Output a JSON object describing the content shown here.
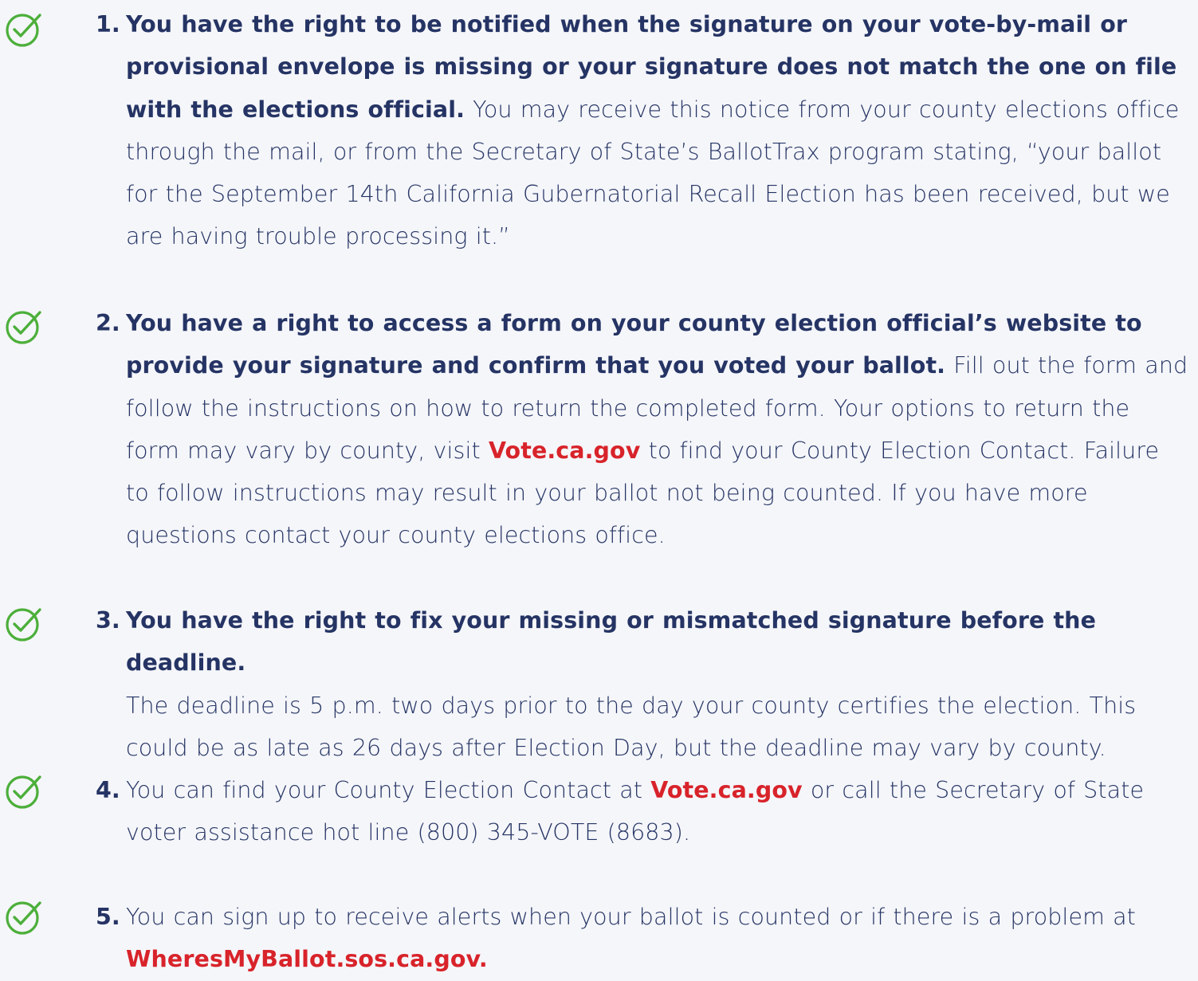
{
  "colors": {
    "background": "#f5f6fa",
    "text": "#253464",
    "link": "#d8232a",
    "check": "#4caf3a"
  },
  "items": [
    {
      "icon": "check-circle-icon",
      "number": "1.",
      "lead": "You have the right to be notified when the signature on your vote-by-mail or provisional envelope is missing or your signature does not match the one on file with the elections official.",
      "body": " You may receive this notice from your county elections office through the mail, or from the Secretary of State’s BallotTrax program stating, “your ballot for the September 14th California Gubernatorial Recall Election has been received, but we are having trouble processing it.”"
    },
    {
      "icon": "check-circle-icon",
      "number": "2.",
      "lead": "You have a right to access a form on your county election official’s website to provide your signature and confirm that you voted your ballot.",
      "body_before_link": " Fill out the form and follow the instructions on how to return the completed form. Your options to return the form may vary by county, visit ",
      "link": "Vote.ca.gov",
      "body_after_link": " to find your County Election Contact. Failure to follow instructions may result in your ballot not being counted. If you have more questions contact your county elections office."
    },
    {
      "icon": "check-circle-icon",
      "number": "3.",
      "lead": "You have the right to fix your missing or mismatched signature before the deadline.",
      "body": "The deadline is 5 p.m. two days prior to the day your county certifies the election. This could be as late as 26 days after Election Day, but the deadline may vary by county."
    },
    {
      "icon": "check-circle-icon",
      "number": "4.",
      "body_before_link": "You can find your County Election Contact at ",
      "link": "Vote.ca.gov",
      "body_after_link": " or call the Secretary of State voter assistance hot line (800) 345-VOTE (8683)."
    },
    {
      "icon": "check-circle-icon",
      "number": "5.",
      "body_before_link": "You can sign up to receive alerts when your ballot is counted or if there is a problem at ",
      "link": "WheresMyBallot.sos.ca.gov."
    }
  ]
}
